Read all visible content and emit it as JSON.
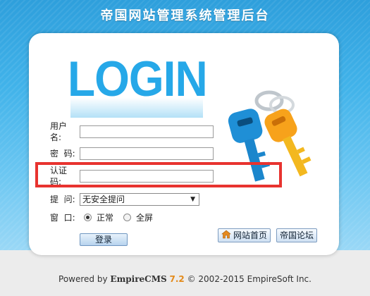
{
  "header": {
    "title": "帝国网站管理系统管理后台"
  },
  "logo": {
    "text": "LOGIN"
  },
  "form": {
    "username_label_line1": "用户",
    "username_label_line2": "名:",
    "password_label": "密  码:",
    "captcha_label_line1": "认证",
    "captcha_label_line2": "码:",
    "question_label": "提  问:",
    "question_selected": "无安全提问",
    "window_label": "窗  口:",
    "window_normal": "正常",
    "window_fullscreen": "全屏",
    "login_button": "登录"
  },
  "links": {
    "home": "网站首页",
    "forum": "帝国论坛"
  },
  "footer": {
    "powered_by": "Powered by",
    "product": "EmpireCMS",
    "version": "7.2",
    "copyright": "© 2002-2015 EmpireSoft Inc."
  },
  "colors": {
    "accent": "#26a8e8",
    "highlight": "#e8332f"
  }
}
